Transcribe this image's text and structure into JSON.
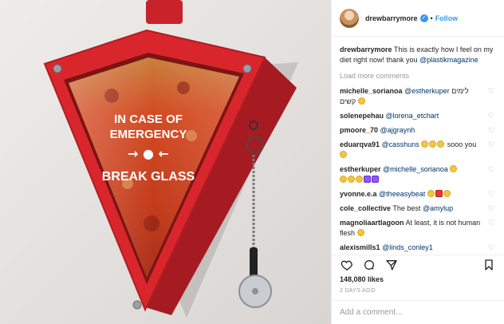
{
  "post": {
    "image": {
      "sign_line1": "IN CASE OF",
      "sign_line2": "EMERGENCY",
      "sign_line3": "BREAK GLASS",
      "arrows": "→ ● ←"
    },
    "author": {
      "username": "drewbarrymore",
      "verified": true,
      "separator": "•",
      "follow_label": "Follow"
    },
    "caption": {
      "username": "drewbarrymore",
      "text": "This is exactly how I feel on my diet right now! thank you",
      "mention": "@plastikmagazine"
    },
    "load_more": "Load more comments",
    "comments": [
      {
        "user": "michelle_sorianoa",
        "mention": "@estherkuper",
        "text": "לימים קשים",
        "emojis": [
          "yellow"
        ]
      },
      {
        "user": "solenepehau",
        "mention": "@lorena_etchart",
        "text": "",
        "emojis": []
      },
      {
        "user": "pmoore_70",
        "mention": "@ajgraynh",
        "text": "",
        "emojis": []
      },
      {
        "user": "eduarqva91",
        "mention": "@casshuns",
        "text": "sooo you",
        "emojis_before": [
          "yellow",
          "yellow",
          "yellow"
        ],
        "emojis": [
          "yellow"
        ]
      },
      {
        "user": "estherkuper",
        "mention": "@michelle_sorianoa",
        "text": "",
        "emojis": [
          "yellow",
          "yellow",
          "yellow",
          "yellow",
          "purple",
          "purple"
        ]
      },
      {
        "user": "yvonne.e.a",
        "mention": "@theeasybeat",
        "text": "",
        "emojis": [
          "yellow",
          "red",
          "yellow"
        ]
      },
      {
        "user": "cole_collective",
        "mention": "@amylup",
        "text": "The best",
        "emojis": []
      },
      {
        "user": "magnoliaartlagoon",
        "mention": "",
        "text": "At least, it is not human flesh",
        "emojis": [
          "yellow"
        ]
      },
      {
        "user": "alexismills1",
        "mention": "@linds_conley1",
        "text": "",
        "emojis": []
      }
    ],
    "likes": "148,080 likes",
    "time_ago": "2 DAYS AGO",
    "add_comment_placeholder": "Add a comment...",
    "colors": {
      "accent": "#3897f0",
      "case_red": "#d9262c",
      "wall": "#e9e7e5"
    },
    "icons": {
      "like": "heart-icon",
      "comment": "comment-icon",
      "share": "share-icon",
      "save": "bookmark-icon"
    }
  }
}
